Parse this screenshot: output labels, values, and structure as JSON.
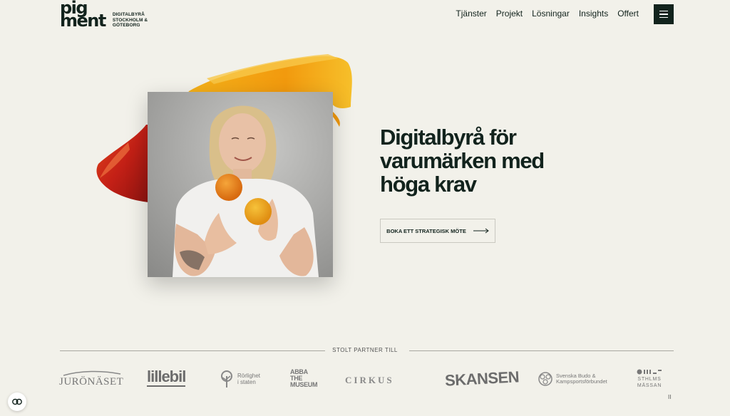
{
  "header": {
    "logo_line1": "pig",
    "logo_line2": "ment",
    "logo_sub": [
      "DIGITALBYRÅ",
      "STOCKHOLM &",
      "GÖTEBORG"
    ],
    "nav": [
      "Tjänster",
      "Projekt",
      "Lösningar",
      "Insights",
      "Offert"
    ],
    "menu_icon": "hamburger-icon"
  },
  "hero": {
    "headline": [
      "Digitalbyrå för",
      "varumärken med",
      "höga krav"
    ],
    "cta_label": "BOKA ETT STRATEGISK MÖTE",
    "cta_icon": "arrow-right-icon",
    "accent_orange": "#f2a10f",
    "accent_red": "#c8201a"
  },
  "partners": {
    "title": "STOLT PARTNER TILL",
    "juronaset": "JURÖNÄSET",
    "lillebil": "lillebil",
    "rorlighet": [
      "Rörlighet",
      "i staten"
    ],
    "abba": [
      "ABBA",
      "THE",
      "MUSEUM"
    ],
    "cirkus": "CIRKUS",
    "skansen": "SKANSEN",
    "budo": [
      "Svenska Budo &",
      "Kampsportsförbundet"
    ],
    "sthlms": [
      "STHLMS",
      "MÄSSAN"
    ],
    "pause": "II"
  },
  "colors": {
    "background": "#f2f1ea",
    "text_dark": "#12231d"
  }
}
